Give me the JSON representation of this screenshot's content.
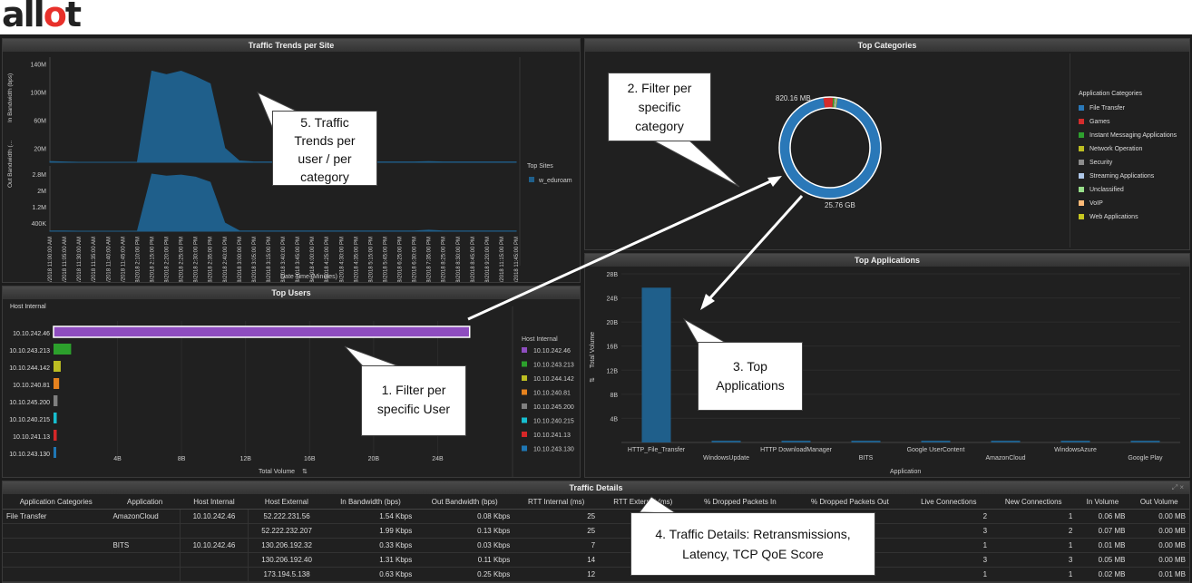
{
  "logo": {
    "text_a": "all",
    "text_o": "o",
    "text_t": "t"
  },
  "panels": {
    "trends": {
      "title": "Traffic Trends per Site",
      "y1_label": "In Bandwidth (bps)",
      "y2_label": "Out Bandwidth (...",
      "x_label": "Date Time (Minutes)",
      "legend_title": "Top Sites",
      "legend_item": "w_eduroam"
    },
    "categories": {
      "title": "Top Categories",
      "legend_title": "Application Categories",
      "label_small": "820.16 MB",
      "label_big": "25.76 GB"
    },
    "users": {
      "title": "Top Users",
      "col_header": "Host Internal",
      "x_label": "Total Volume",
      "legend_title": "Host Internal"
    },
    "apps": {
      "title": "Top Applications",
      "y_label": "Total Volume",
      "x_label": "Application"
    },
    "details": {
      "title": "Traffic Details"
    }
  },
  "colors": {
    "blue": "#1f5f8b",
    "purple": "#8e4dbf",
    "donut_blue": "#2a78b8"
  },
  "chart_data": [
    {
      "type": "area",
      "title": "Traffic Trends per Site",
      "xlabel": "Date Time (Minutes)",
      "x": [
        "9/18/2018 11:00:00 AM",
        "9/18/2018 11:05:00 AM",
        "9/18/2018 11:30:00 AM",
        "9/18/2018 11:35:00 AM",
        "9/18/2018 11:40:00 AM",
        "9/18/2018 11:45:00 AM",
        "9/18/2018 2:10:00 PM",
        "9/18/2018 2:15:00 PM",
        "9/18/2018 2:20:00 PM",
        "9/18/2018 2:25:00 PM",
        "9/18/2018 2:30:00 PM",
        "9/18/2018 2:35:00 PM",
        "9/18/2018 2:40:00 PM",
        "9/18/2018 3:00:00 PM",
        "9/18/2018 3:05:00 PM",
        "9/18/2018 3:15:00 PM",
        "9/18/2018 3:40:00 PM",
        "9/18/2018 3:45:00 PM",
        "9/18/2018 4:00:00 PM",
        "9/18/2018 4:25:00 PM",
        "9/18/2018 4:30:00 PM",
        "9/18/2018 4:35:00 PM",
        "9/18/2018 5:15:00 PM",
        "9/18/2018 5:45:00 PM",
        "9/18/2018 6:25:00 PM",
        "9/18/2018 6:30:00 PM",
        "9/18/2018 7:35:00 PM",
        "9/18/2018 8:25:00 PM",
        "9/18/2018 8:30:00 PM",
        "9/18/2018 8:45:00 PM",
        "9/18/2018 9:20:00 PM",
        "9/18/2018 11:15:00 PM",
        "9/18/2018 11:45:00 PM"
      ],
      "series": [
        {
          "name": "w_eduroam",
          "axis": "In Bandwidth (bps)",
          "values": [
            1,
            0.5,
            0,
            0,
            0,
            0,
            0,
            130,
            125,
            130,
            122,
            112,
            20,
            2,
            0.5,
            0.5,
            0.5,
            0.5,
            0.5,
            0.5,
            0.5,
            0.5,
            0.5,
            0.5,
            0.5,
            0.5,
            1,
            0.5,
            0.5,
            0.5,
            0.5,
            0.5,
            0.5
          ]
        },
        {
          "name": "w_eduroam",
          "axis": "Out Bandwidth (...)",
          "values": [
            0.01,
            0.01,
            0,
            0,
            0,
            0,
            0,
            2.8,
            2.7,
            2.75,
            2.65,
            2.4,
            0.4,
            0.02,
            0.01,
            0.01,
            0.01,
            0.01,
            0.01,
            0.01,
            0.01,
            0.01,
            0.01,
            0.01,
            0.01,
            0.01,
            0.05,
            0.01,
            0.01,
            0.01,
            0.01,
            0.01,
            0.01
          ]
        }
      ],
      "y1_ticks": [
        "140M",
        "100M",
        "60M",
        "20M"
      ],
      "y2_ticks": [
        "2.8M",
        "2M",
        "1.2M",
        "400K"
      ],
      "legend": "Top Sites"
    },
    {
      "type": "pie",
      "title": "Top Categories",
      "categories": [
        "File Transfer",
        "Games",
        "Instant Messaging Applications",
        "Network Operation",
        "Security",
        "Streaming Applications",
        "Unclassified",
        "VoIP",
        "Web Applications"
      ],
      "colors": [
        "#2a78b8",
        "#d42c2c",
        "#2ea02e",
        "#bcbd22",
        "#8c8c8c",
        "#aec7e8",
        "#98df8a",
        "#ffbb78",
        "#c7c720"
      ],
      "values": [
        25.76,
        0.82,
        0.1,
        0.05,
        0.05,
        0.05,
        0.08,
        0.03,
        0.03
      ],
      "data_labels": [
        "25.76 GB",
        "820.16 MB"
      ]
    },
    {
      "type": "bar",
      "title": "Top Users",
      "orientation": "horizontal",
      "categories": [
        "10.10.242.46",
        "10.10.243.213",
        "10.10.244.142",
        "10.10.240.81",
        "10.10.245.200",
        "10.10.240.215",
        "10.10.241.13",
        "10.10.243.130"
      ],
      "values": [
        26,
        1.1,
        0.45,
        0.35,
        0.25,
        0.2,
        0.2,
        0.15
      ],
      "colors": [
        "#8e4dbf",
        "#2ca02c",
        "#bcbd22",
        "#e6821e",
        "#7f7f7f",
        "#17becf",
        "#d62728",
        "#1f77b4"
      ],
      "xticks": [
        "4B",
        "8B",
        "12B",
        "16B",
        "20B",
        "24B"
      ],
      "xlim": [
        0,
        28
      ],
      "xlabel": "Total Volume"
    },
    {
      "type": "bar",
      "title": "Top Applications",
      "categories": [
        "HTTP_File_Transfer",
        "WindowsUpdate",
        "HTTP DownloadManager",
        "BITS",
        "Google UserContent",
        "AmazonCloud",
        "WindowsAzure",
        "Google Play"
      ],
      "values": [
        25.7,
        0.2,
        0.15,
        0.12,
        0.1,
        0.1,
        0.1,
        0.08
      ],
      "yticks": [
        "4B",
        "8B",
        "12B",
        "16B",
        "20B",
        "24B",
        "28B"
      ],
      "ylim": [
        0,
        28
      ],
      "ylabel": "Total Volume",
      "xlabel": "Application"
    }
  ],
  "details_table": {
    "columns": [
      "Application Categories",
      "Application",
      "Host Internal",
      "Host External",
      "In Bandwidth (bps)",
      "Out Bandwidth (bps)",
      "RTT Internal (ms)",
      "RTT External (ms)",
      "% Dropped Packets In",
      "% Dropped Packets Out",
      "Live Connections",
      "New Connections",
      "In Volume",
      "Out Volume"
    ],
    "rows": [
      [
        "File Transfer",
        "AmazonCloud",
        "10.10.242.46",
        "52.222.231.56",
        "1.54 Kbps",
        "0.08 Kbps",
        "25",
        "",
        "",
        "",
        "2",
        "1",
        "0.06 MB",
        "0.00 MB"
      ],
      [
        "",
        "",
        "",
        "52.222.232.207",
        "1.99 Kbps",
        "0.13 Kbps",
        "25",
        "",
        "",
        "",
        "3",
        "2",
        "0.07 MB",
        "0.00 MB"
      ],
      [
        "",
        "BITS",
        "10.10.242.46",
        "130.206.192.32",
        "0.33 Kbps",
        "0.03 Kbps",
        "7",
        "",
        "",
        "",
        "1",
        "1",
        "0.01 MB",
        "0.00 MB"
      ],
      [
        "",
        "",
        "",
        "130.206.192.40",
        "1.31 Kbps",
        "0.11 Kbps",
        "14",
        "",
        "",
        "",
        "3",
        "3",
        "0.05 MB",
        "0.00 MB"
      ],
      [
        "",
        "",
        "",
        "173.194.5.138",
        "0.63 Kbps",
        "0.25 Kbps",
        "12",
        "",
        "",
        "",
        "1",
        "1",
        "0.02 MB",
        "0.01 MB"
      ]
    ]
  },
  "callouts": {
    "c1": [
      "1. Filter per",
      "specific User"
    ],
    "c2": [
      "2. Filter per",
      "specific",
      "category"
    ],
    "c3": [
      "3. Top",
      "Applications"
    ],
    "c4": [
      "4. Traffic Details: Retransmissions,",
      "Latency, TCP QoE Score"
    ],
    "c5": [
      "5. Traffic",
      "Trends per",
      "user / per",
      "category"
    ]
  },
  "icons": {
    "sort": "sort-icon"
  }
}
